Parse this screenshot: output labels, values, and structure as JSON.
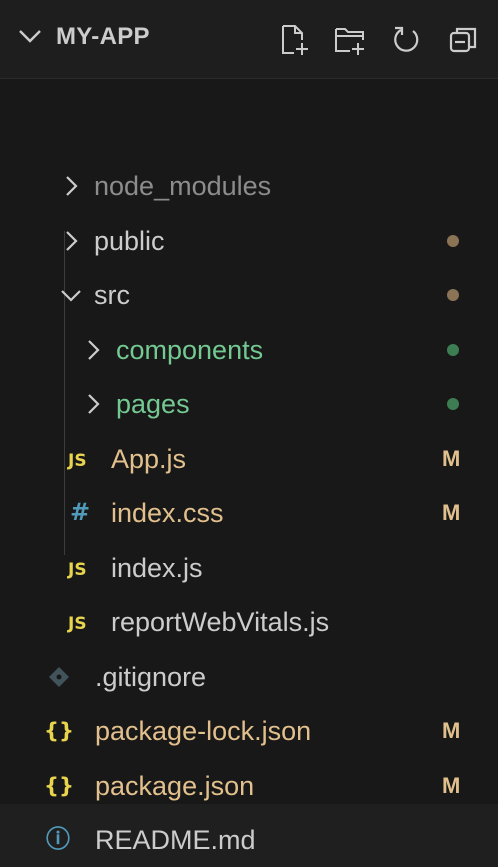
{
  "explorer": {
    "title": "MY-APP",
    "actions": [
      {
        "name": "new-file-icon"
      },
      {
        "name": "new-folder-icon"
      },
      {
        "name": "refresh-icon"
      },
      {
        "name": "collapse-all-icon"
      }
    ]
  },
  "colors": {
    "folder_text": "#cccccc",
    "ignored_text": "#8c8c8c",
    "untracked_green": "#73c991",
    "modified_yellow": "#e2c08d",
    "dot_brown": "#8b7355",
    "dot_green": "#3d7d52",
    "js_icon": "#e8d44d",
    "css_icon": "#519aba",
    "json_icon": "#e8d44d",
    "info_icon": "#519aba",
    "git_icon": "#41535b"
  },
  "tree": {
    "items": [
      {
        "label": "node_modules",
        "type": "folder",
        "expanded": false,
        "depth": 1,
        "status": ""
      },
      {
        "label": "public",
        "type": "folder",
        "expanded": false,
        "depth": 1,
        "status": "dot"
      },
      {
        "label": "src",
        "type": "folder",
        "expanded": true,
        "depth": 1,
        "status": "dot"
      },
      {
        "label": "components",
        "type": "folder",
        "expanded": false,
        "depth": 2,
        "status": "dot"
      },
      {
        "label": "pages",
        "type": "folder",
        "expanded": false,
        "depth": 2,
        "status": "dot"
      },
      {
        "label": "App.js",
        "type": "file",
        "icon": "JS",
        "depth": 2,
        "status": "M"
      },
      {
        "label": "index.css",
        "type": "file",
        "icon": "#",
        "depth": 2,
        "status": "M"
      },
      {
        "label": "index.js",
        "type": "file",
        "icon": "JS",
        "depth": 2,
        "status": ""
      },
      {
        "label": "reportWebVitals.js",
        "type": "file",
        "icon": "JS",
        "depth": 2,
        "status": ""
      },
      {
        "label": ".gitignore",
        "type": "file",
        "icon": "git-diamond",
        "depth": 1,
        "status": ""
      },
      {
        "label": "package-lock.json",
        "type": "file",
        "icon": "{}",
        "depth": 1,
        "status": "M"
      },
      {
        "label": "package.json",
        "type": "file",
        "icon": "{}",
        "depth": 1,
        "status": "M"
      },
      {
        "label": "README.md",
        "type": "file",
        "icon": "ⓘ",
        "depth": 1,
        "status": ""
      }
    ]
  }
}
